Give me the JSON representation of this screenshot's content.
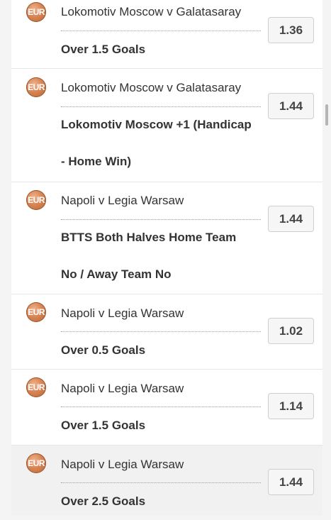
{
  "currency_badge": "EUR",
  "bets": [
    {
      "event": "Lokomotiv Moscow v Galatasaray",
      "selection": "Over 1.5 Goals",
      "odds": "1.36"
    },
    {
      "event": "Lokomotiv Moscow v Galatasaray",
      "selection": "Lokomotiv Moscow +1 (Handicap - Home Win)",
      "odds": "1.44"
    },
    {
      "event": "Napoli v Legia Warsaw",
      "selection": "BTTS Both Halves Home Team No / Away Team No",
      "odds": "1.44"
    },
    {
      "event": "Napoli v Legia Warsaw",
      "selection": "Over 0.5 Goals",
      "odds": "1.02"
    },
    {
      "event": "Napoli v Legia Warsaw",
      "selection": "Over 1.5 Goals",
      "odds": "1.14"
    },
    {
      "event": "Napoli v Legia Warsaw",
      "selection": "Over 2.5 Goals",
      "odds": "1.44"
    }
  ]
}
